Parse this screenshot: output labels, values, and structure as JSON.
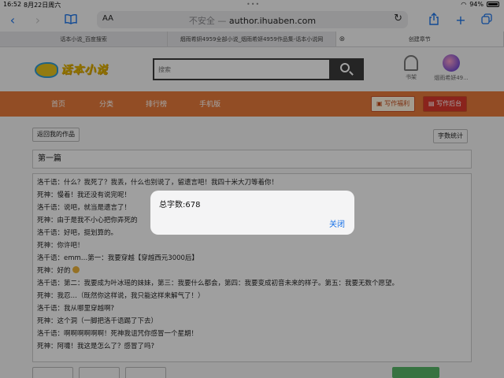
{
  "status_bar": {
    "time": "16:52",
    "date": "8月22日周六",
    "battery": "94%"
  },
  "browser": {
    "aa_label": "AA",
    "insecure_label": "不安全 —",
    "url": "author.ihuaben.com",
    "tabs": [
      {
        "title": "话本小说_百度搜索"
      },
      {
        "title": "烟雨希妍4959全部小说_烟雨希妍4959作品集-话本小说网"
      },
      {
        "title": "创建章节"
      }
    ]
  },
  "site": {
    "logo_text": "话本小说",
    "search_placeholder": "搜索",
    "bookshelf_label": "书架",
    "username": "烟雨希妍49...",
    "nav": [
      "首页",
      "分类",
      "排行榜",
      "手机版"
    ],
    "welfare_button": "写作福利",
    "studio_button": "写作后台"
  },
  "editor": {
    "back_button": "返回我的作品",
    "word_count_button": "字数统计",
    "chapter_title": "第一篇",
    "lines": [
      "洛千语：什么？我死了？我丢，什么也别说了，留遗言吧！我四十米大刀等着你！",
      "死神：慢着！我还没有说完呢！",
      "洛千语：说吧，就当是遗言了！",
      "死神：由于是我不小心把你弄死的",
      "洛千语：好吧，挺划算的。",
      "死神：你许吧！",
      "洛千语：emm…第一：我要穿越【穿越西元3000后】",
      "死神：好的",
      "洛千语：第二：我要成为叶冰瑶的妹妹，第三：我要什么都会，第四：我要变成初音未来的样子。第五：我要无数个愿望。",
      "死神：我忍…（既然你这样说，我只能这样来解气了！）",
      "洛千语：我从哪里穿越啊?",
      "死神：这个洞（一脚把洛千语踢了下去）",
      "洛千语：啊啊啊啊啊啊！死神我诅咒你感冒一个星期！",
      "死神：阿嚏！我这是怎么了？感冒了吗?"
    ]
  },
  "alert": {
    "message": "总字数:678",
    "close_label": "关闭"
  }
}
